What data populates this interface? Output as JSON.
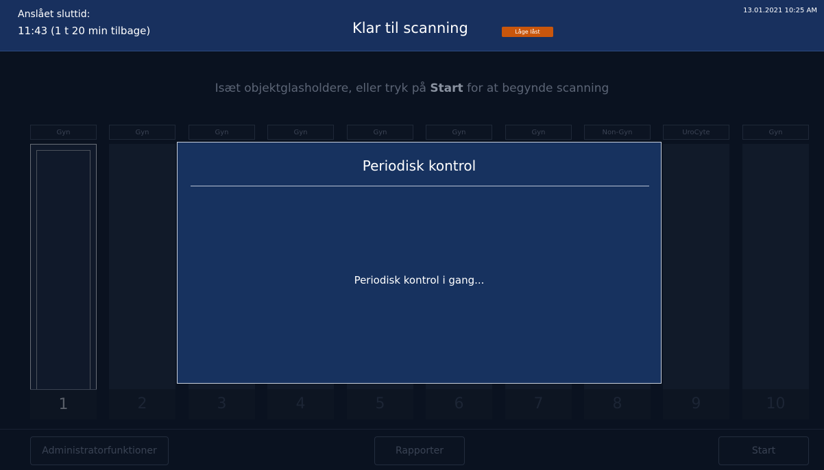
{
  "header": {
    "estimated_label": "Anslået sluttid:",
    "estimated_value": "11:43 (1 t 20 min tilbage)",
    "title": "Klar til scanning",
    "badge": "Låge låst",
    "datetime": "13.01.2021 10:25 AM"
  },
  "instruction": {
    "prefix": "Isæt objektglasholdere, eller tryk på ",
    "bold": "Start",
    "suffix": " for at begynde scanning"
  },
  "slots": [
    {
      "label": "Gyn",
      "number": "1"
    },
    {
      "label": "Gyn",
      "number": "2"
    },
    {
      "label": "Gyn",
      "number": "3"
    },
    {
      "label": "Gyn",
      "number": "4"
    },
    {
      "label": "Gyn",
      "number": "5"
    },
    {
      "label": "Gyn",
      "number": "6"
    },
    {
      "label": "Gyn",
      "number": "7"
    },
    {
      "label": "Non-Gyn",
      "number": "8"
    },
    {
      "label": "UroCyte",
      "number": "9"
    },
    {
      "label": "Gyn",
      "number": "10"
    }
  ],
  "footer": {
    "admin_label": "Administratorfunktioner",
    "reports_label": "Rapporter",
    "start_label": "Start"
  },
  "modal": {
    "title": "Periodisk kontrol",
    "message": "Periodisk kontrol i gang..."
  },
  "colors": {
    "header_bg": "#18305e",
    "modal_bg": "#17325f",
    "badge_bg": "#c9560c",
    "background": "#0a1220"
  }
}
